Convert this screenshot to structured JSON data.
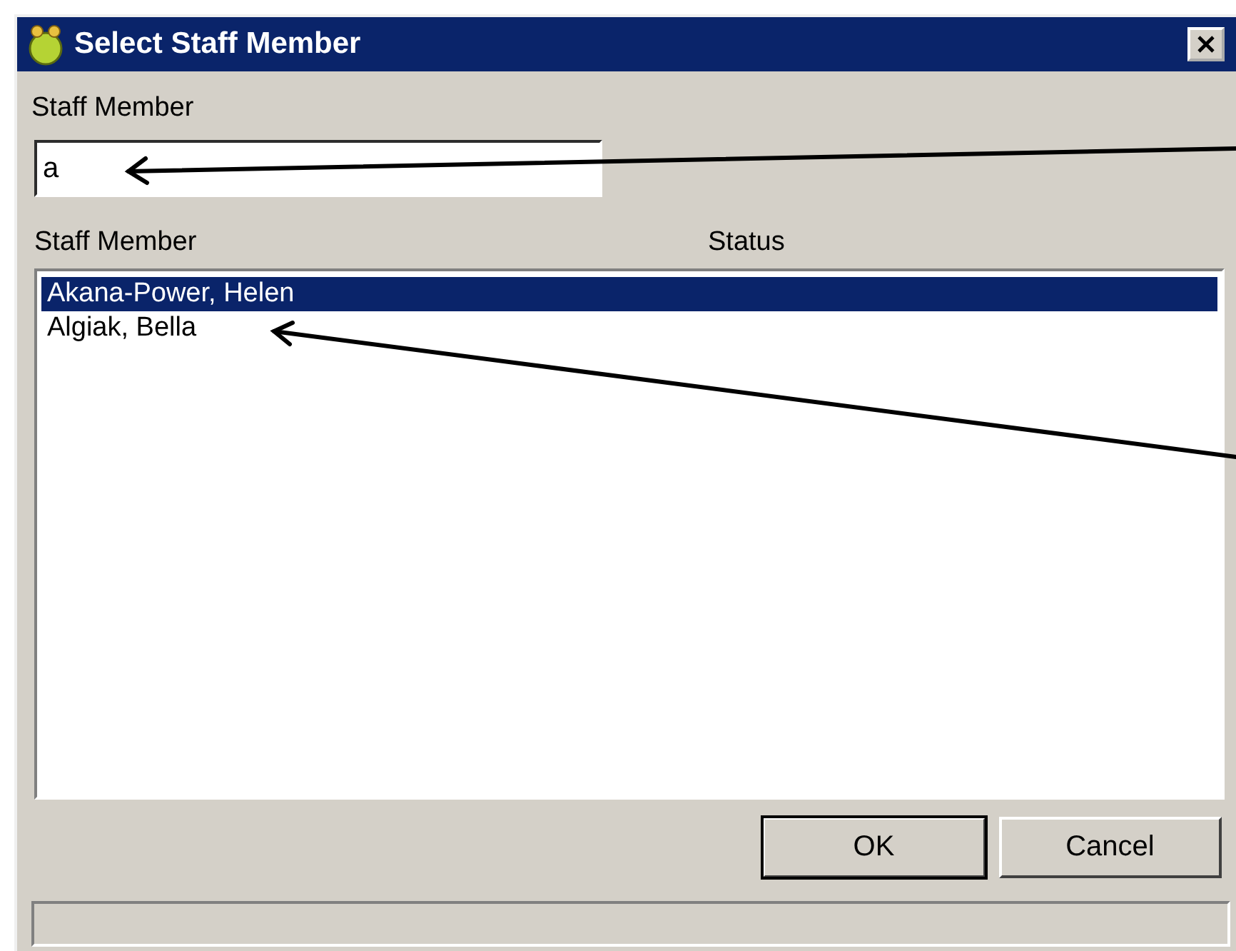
{
  "window": {
    "title": "Select Staff Member"
  },
  "filter": {
    "label": "Staff Member",
    "value": "a"
  },
  "list": {
    "columns": [
      "Staff Member",
      "Status"
    ],
    "rows": [
      {
        "name": "Akana-Power, Helen",
        "selected": true
      },
      {
        "name": "Algiak, Bella",
        "selected": false
      }
    ]
  },
  "buttons": [
    {
      "label": "OK",
      "default": true
    },
    {
      "label": "Cancel",
      "default": false
    }
  ]
}
